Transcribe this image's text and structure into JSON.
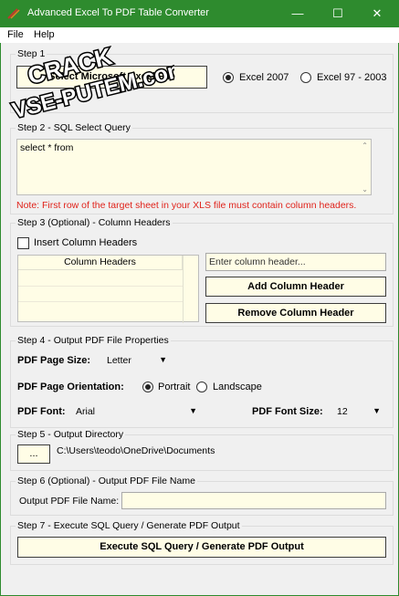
{
  "window": {
    "title": "Advanced Excel To PDF Table Converter"
  },
  "menu": {
    "file": "File",
    "help": "Help"
  },
  "watermark": {
    "line1": "CRACK",
    "line2": "VSE-PUTEM.com"
  },
  "step1": {
    "legend": "Step 1",
    "button_label": "Select Microsoft Excel File",
    "radio_excel2007": "Excel 2007",
    "radio_excel97": "Excel 97 - 2003",
    "selected": "Excel 2007"
  },
  "step2": {
    "legend": "Step 2 - SQL Select Query",
    "query": "select * from",
    "note": "Note: First row of the target sheet in your XLS file must contain column headers."
  },
  "step3": {
    "legend": "Step 3 (Optional) - Column Headers",
    "checkbox_label": "Insert Column Headers",
    "list_header": "Column Headers",
    "input_placeholder": "Enter column header...",
    "add_button": "Add Column Header",
    "remove_button": "Remove Column Header"
  },
  "step4": {
    "legend": "Step 4 - Output PDF File Properties",
    "page_size_label": "PDF Page Size:",
    "page_size_value": "Letter",
    "orientation_label": "PDF Page Orientation:",
    "portrait": "Portrait",
    "landscape": "Landscape",
    "orientation_selected": "Portrait",
    "font_label": "PDF Font:",
    "font_value": "Arial",
    "font_size_label": "PDF Font Size:",
    "font_size_value": "12"
  },
  "step5": {
    "legend": "Step 5 - Output Directory",
    "browse_label": "...",
    "path": "C:\\Users\\teodo\\OneDrive\\Documents"
  },
  "step6": {
    "legend": "Step 6 (Optional) - Output PDF File Name",
    "field_label": "Output PDF File Name:",
    "value": ""
  },
  "step7": {
    "legend": "Step 7 - Execute SQL Query / Generate PDF Output",
    "button_label": "Execute SQL Query / Generate PDF Output"
  }
}
